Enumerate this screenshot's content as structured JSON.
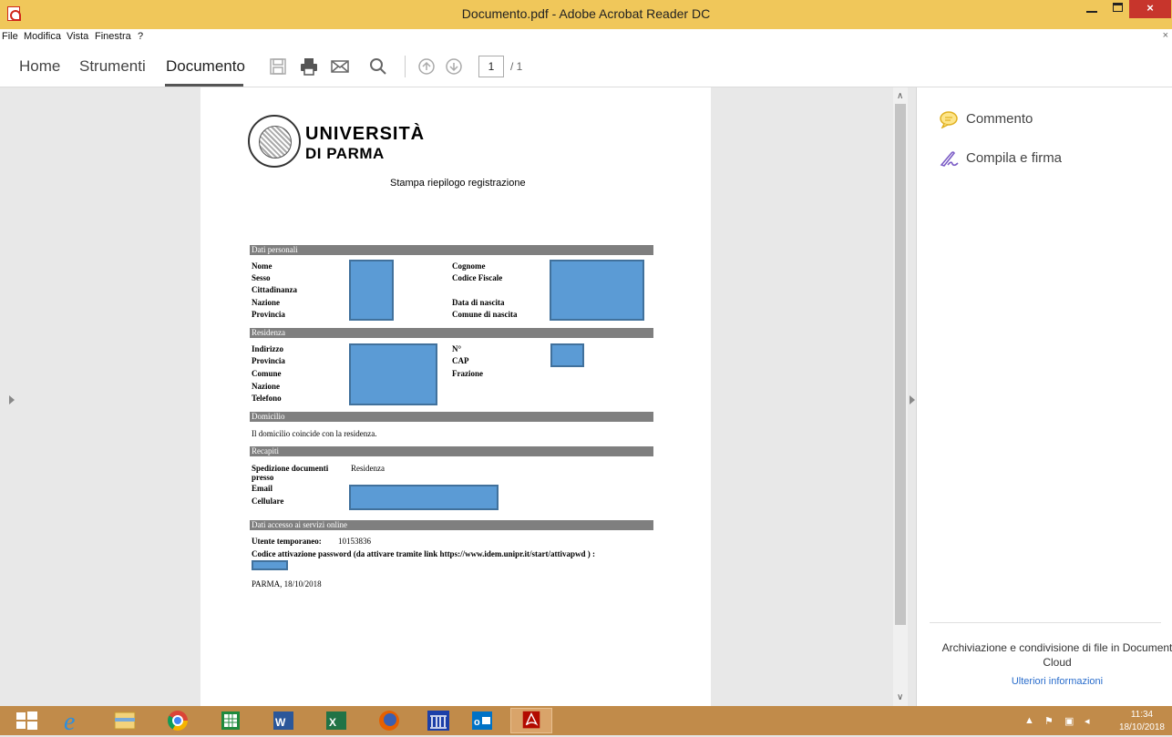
{
  "window": {
    "title": "Documento.pdf - Adobe Acrobat Reader DC",
    "minimize": "–",
    "close": "×"
  },
  "menu": {
    "items": [
      "File",
      "Modifica",
      "Vista",
      "Finestra",
      "?"
    ],
    "close": "×"
  },
  "toolbar": {
    "tabs": [
      "Home",
      "Strumenti",
      "Documento"
    ],
    "active_tab": "Documento",
    "current_page": "1",
    "total_pages": "/ 1"
  },
  "right_panel": {
    "items": [
      "Commento",
      "Compila e firma"
    ],
    "cloud_text": "Archiviazione e condivisione di file in Document Cloud",
    "link": "Ulteriori informazioni"
  },
  "document": {
    "university_line1": "UNIVERSITÀ",
    "university_line2": "DI PARMA",
    "subtitle": "Stampa riepilogo registrazione",
    "sections": {
      "personal": "Dati personali",
      "residence": "Residenza",
      "domicile": "Domicilio",
      "contacts": "Recapiti",
      "access": "Dati accesso ai servizi online"
    },
    "personal_left": [
      "Nome",
      "Sesso",
      "Cittadinanza",
      "Nazione",
      "Provincia"
    ],
    "personal_right": [
      "Cognome",
      "Codice Fiscale",
      "",
      "Data di nascita",
      "Comune di nascita"
    ],
    "residence_left": [
      "Indirizzo",
      "Provincia",
      "Comune",
      "Nazione",
      "Telefono"
    ],
    "residence_right": [
      "N°",
      "CAP",
      "Frazione"
    ],
    "domicile_text": "Il domicilio coincide con la residenza.",
    "contacts": {
      "shipping_label_1": "Spedizione documenti",
      "shipping_label_2": "presso",
      "shipping_value": "Residenza",
      "email_label": "Email",
      "mobile_label": "Cellulare"
    },
    "access": {
      "user_label": "Utente temporaneo:",
      "user_value": "10153836",
      "code_label": "Codice attivazione password (da attivare tramite link https://www.idem.unipr.it/start/attivapwd ) :"
    },
    "place_date": "PARMA, 18/10/2018"
  },
  "taskbar": {
    "time": "11:34",
    "date": "18/10/2018"
  },
  "colors": {
    "titlebar": "#f0c75a",
    "taskbar": "#c18b4a",
    "redaction": "#5b9bd5",
    "section_bar": "#7f7f7f"
  }
}
